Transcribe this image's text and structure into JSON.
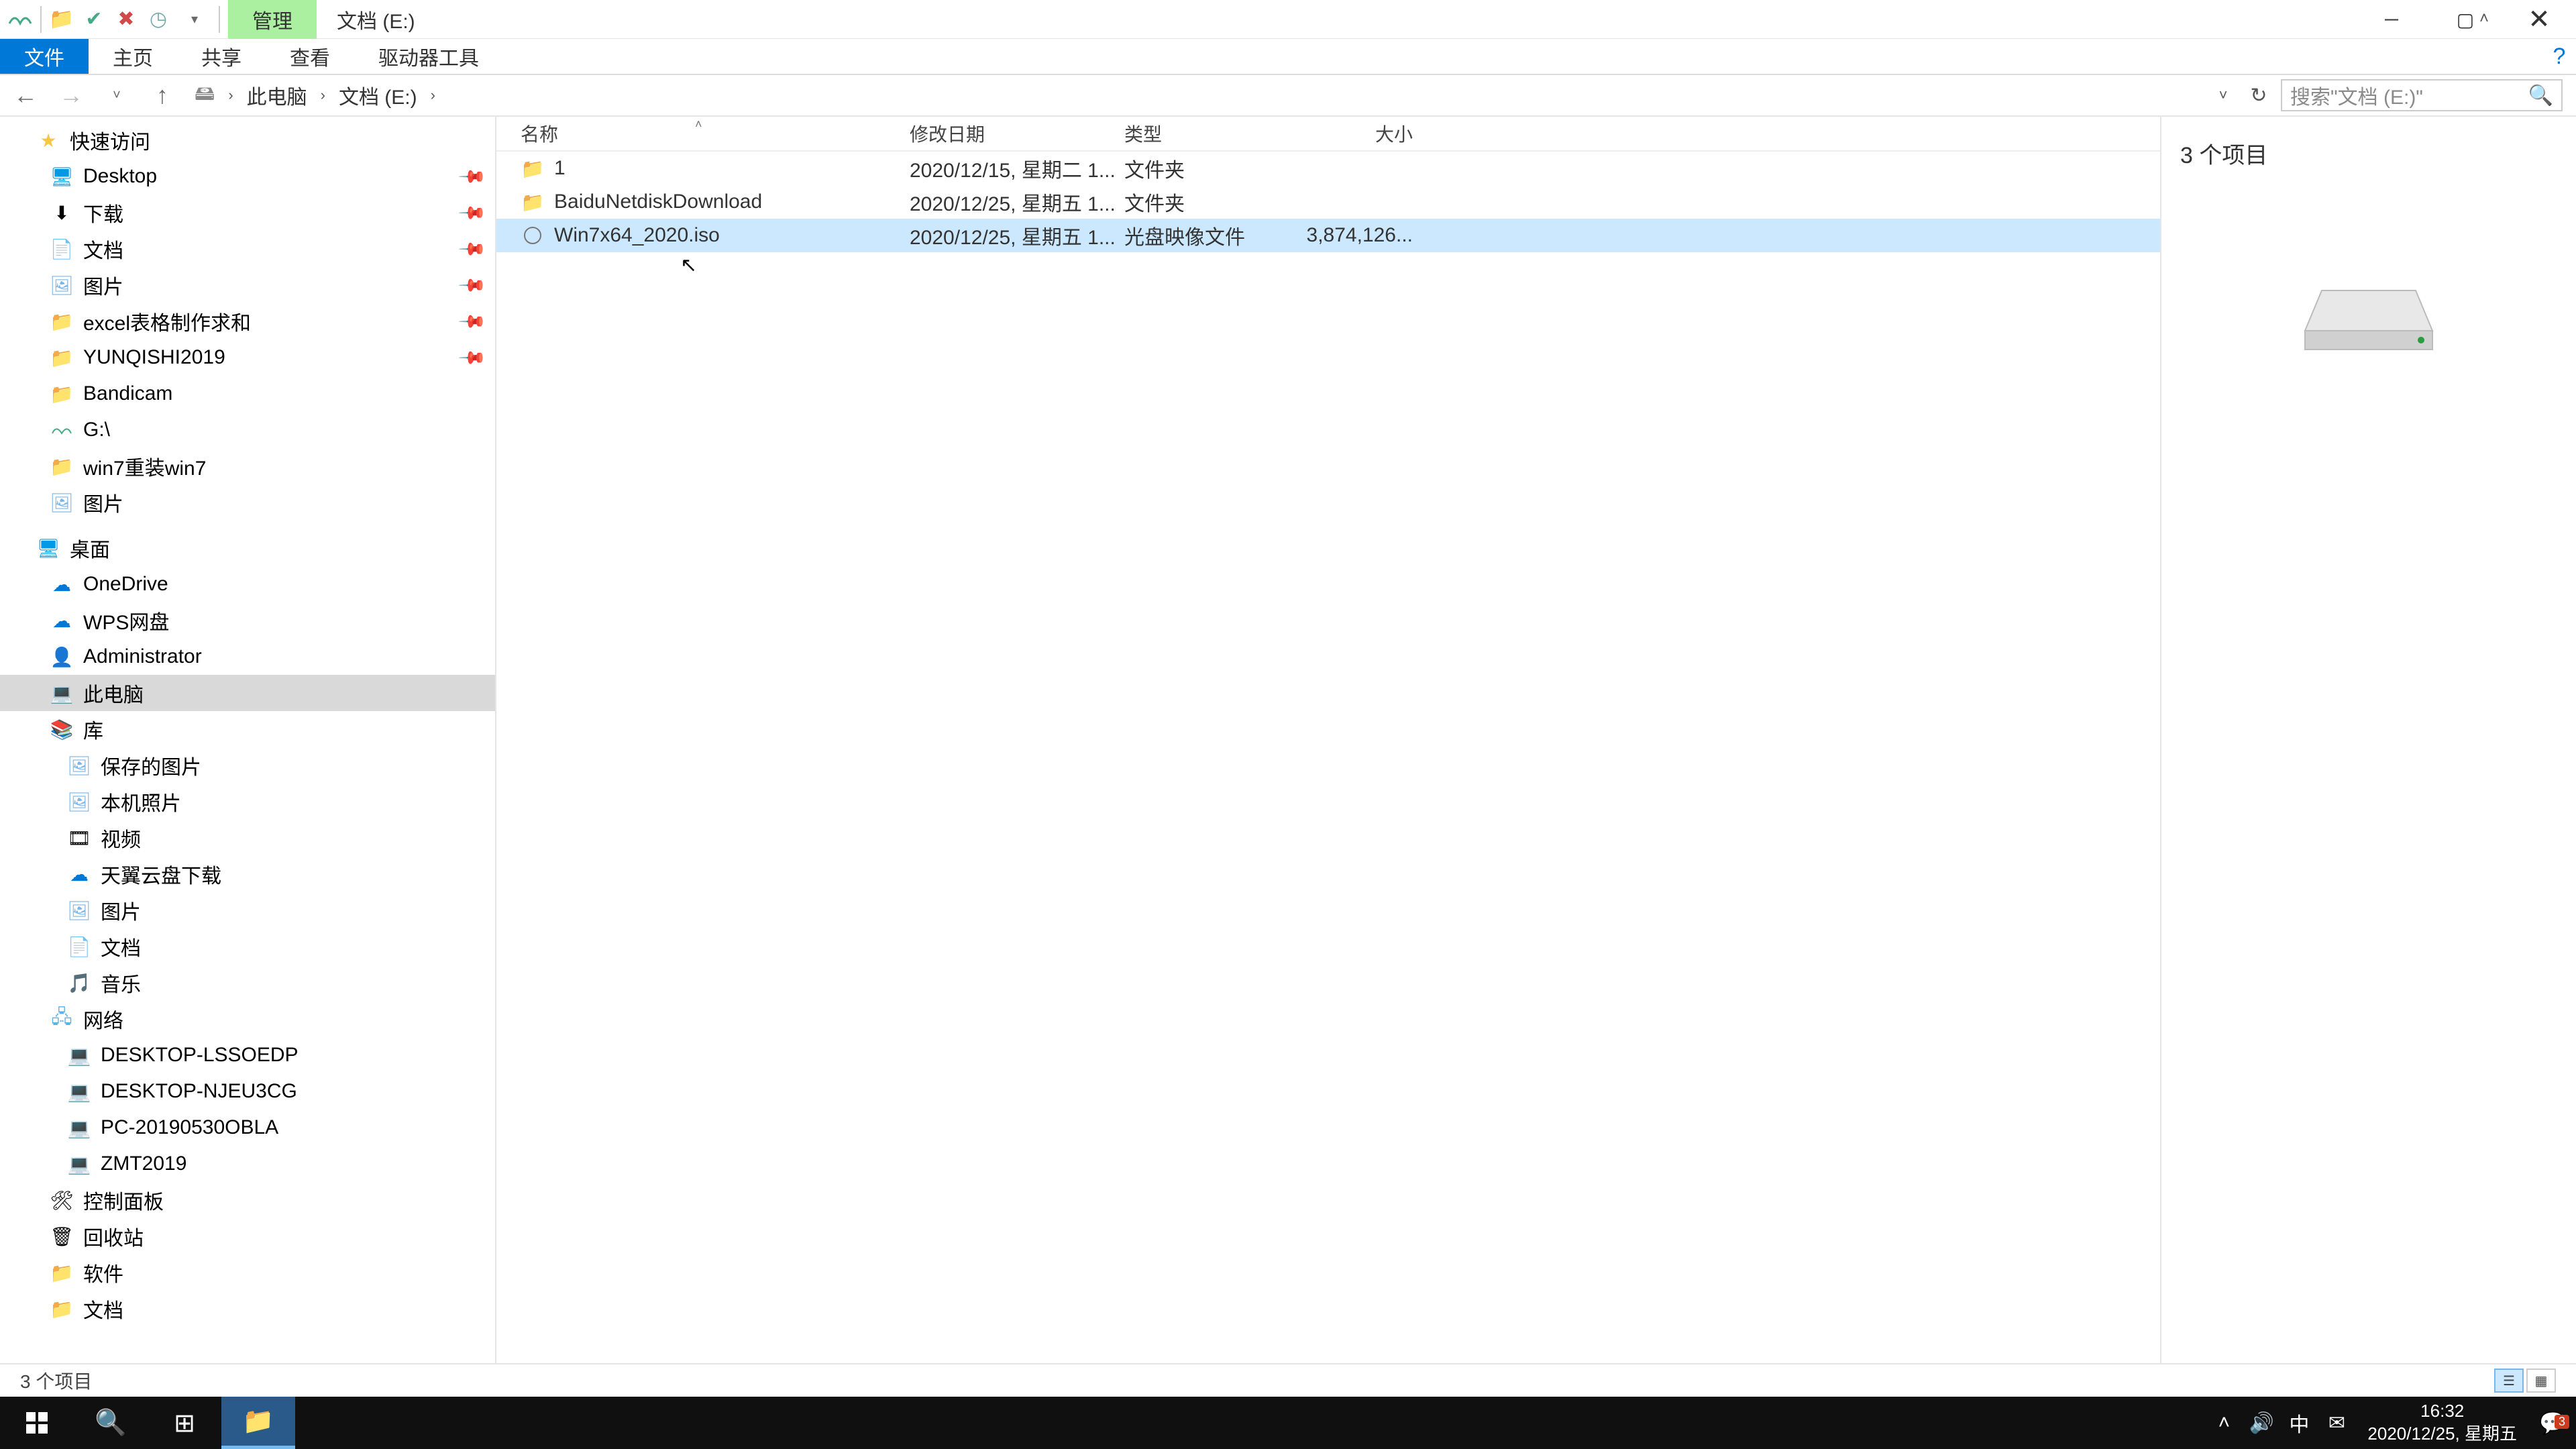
{
  "title_tab": "管理",
  "window_title": "文档 (E:)",
  "ribbon": {
    "file": "文件",
    "home": "主页",
    "share": "共享",
    "view": "查看",
    "drive_tools": "驱动器工具"
  },
  "breadcrumb": {
    "pc": "此电脑",
    "loc": "文档 (E:)"
  },
  "search_placeholder": "搜索\"文档 (E:)\"",
  "columns": {
    "name": "名称",
    "date": "修改日期",
    "type": "类型",
    "size": "大小"
  },
  "rows": [
    {
      "name": "1",
      "date": "2020/12/15, 星期二 1...",
      "type": "文件夹",
      "size": "",
      "icon": "folder"
    },
    {
      "name": "BaiduNetdiskDownload",
      "date": "2020/12/25, 星期五 1...",
      "type": "文件夹",
      "size": "",
      "icon": "folder"
    },
    {
      "name": "Win7x64_2020.iso",
      "date": "2020/12/25, 星期五 1...",
      "type": "光盘映像文件",
      "size": "3,874,126...",
      "icon": "disc"
    }
  ],
  "sidebar": {
    "quick": "快速访问",
    "quick_items": [
      "Desktop",
      "下载",
      "文档",
      "图片",
      "excel表格制作求和",
      "YUNQISHI2019",
      "Bandicam",
      "G:\\",
      "win7重装win7",
      "图片"
    ],
    "desktop": "桌面",
    "desktop_items": [
      "OneDrive",
      "WPS网盘",
      "Administrator",
      "此电脑",
      "库"
    ],
    "lib_items": [
      "保存的图片",
      "本机照片",
      "视频",
      "天翼云盘下载",
      "图片",
      "文档",
      "音乐"
    ],
    "network": "网络",
    "net_items": [
      "DESKTOP-LSSOEDP",
      "DESKTOP-NJEU3CG",
      "PC-20190530OBLA",
      "ZMT2019"
    ],
    "control": "控制面板",
    "recycle": "回收站",
    "soft": "软件",
    "docs": "文档"
  },
  "preview_title": "3 个项目",
  "status": "3 个项目",
  "tray": {
    "ime": "中"
  },
  "clock": {
    "time": "16:32",
    "date": "2020/12/25, 星期五"
  },
  "notif_count": "3"
}
